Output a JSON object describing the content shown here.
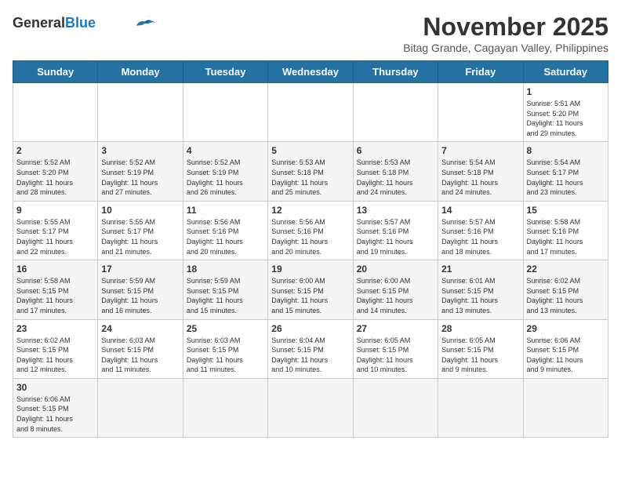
{
  "header": {
    "logo_general": "General",
    "logo_blue": "Blue",
    "month_year": "November 2025",
    "location": "Bitag Grande, Cagayan Valley, Philippines"
  },
  "days_of_week": [
    "Sunday",
    "Monday",
    "Tuesday",
    "Wednesday",
    "Thursday",
    "Friday",
    "Saturday"
  ],
  "weeks": [
    [
      {
        "day": "",
        "content": ""
      },
      {
        "day": "",
        "content": ""
      },
      {
        "day": "",
        "content": ""
      },
      {
        "day": "",
        "content": ""
      },
      {
        "day": "",
        "content": ""
      },
      {
        "day": "",
        "content": ""
      },
      {
        "day": "1",
        "content": "Sunrise: 5:51 AM\nSunset: 5:20 PM\nDaylight: 11 hours\nand 29 minutes."
      }
    ],
    [
      {
        "day": "2",
        "content": "Sunrise: 5:52 AM\nSunset: 5:20 PM\nDaylight: 11 hours\nand 28 minutes."
      },
      {
        "day": "3",
        "content": "Sunrise: 5:52 AM\nSunset: 5:19 PM\nDaylight: 11 hours\nand 27 minutes."
      },
      {
        "day": "4",
        "content": "Sunrise: 5:52 AM\nSunset: 5:19 PM\nDaylight: 11 hours\nand 26 minutes."
      },
      {
        "day": "5",
        "content": "Sunrise: 5:53 AM\nSunset: 5:18 PM\nDaylight: 11 hours\nand 25 minutes."
      },
      {
        "day": "6",
        "content": "Sunrise: 5:53 AM\nSunset: 5:18 PM\nDaylight: 11 hours\nand 24 minutes."
      },
      {
        "day": "7",
        "content": "Sunrise: 5:54 AM\nSunset: 5:18 PM\nDaylight: 11 hours\nand 24 minutes."
      },
      {
        "day": "8",
        "content": "Sunrise: 5:54 AM\nSunset: 5:17 PM\nDaylight: 11 hours\nand 23 minutes."
      }
    ],
    [
      {
        "day": "9",
        "content": "Sunrise: 5:55 AM\nSunset: 5:17 PM\nDaylight: 11 hours\nand 22 minutes."
      },
      {
        "day": "10",
        "content": "Sunrise: 5:55 AM\nSunset: 5:17 PM\nDaylight: 11 hours\nand 21 minutes."
      },
      {
        "day": "11",
        "content": "Sunrise: 5:56 AM\nSunset: 5:16 PM\nDaylight: 11 hours\nand 20 minutes."
      },
      {
        "day": "12",
        "content": "Sunrise: 5:56 AM\nSunset: 5:16 PM\nDaylight: 11 hours\nand 20 minutes."
      },
      {
        "day": "13",
        "content": "Sunrise: 5:57 AM\nSunset: 5:16 PM\nDaylight: 11 hours\nand 19 minutes."
      },
      {
        "day": "14",
        "content": "Sunrise: 5:57 AM\nSunset: 5:16 PM\nDaylight: 11 hours\nand 18 minutes."
      },
      {
        "day": "15",
        "content": "Sunrise: 5:58 AM\nSunset: 5:16 PM\nDaylight: 11 hours\nand 17 minutes."
      }
    ],
    [
      {
        "day": "16",
        "content": "Sunrise: 5:58 AM\nSunset: 5:15 PM\nDaylight: 11 hours\nand 17 minutes."
      },
      {
        "day": "17",
        "content": "Sunrise: 5:59 AM\nSunset: 5:15 PM\nDaylight: 11 hours\nand 16 minutes."
      },
      {
        "day": "18",
        "content": "Sunrise: 5:59 AM\nSunset: 5:15 PM\nDaylight: 11 hours\nand 15 minutes."
      },
      {
        "day": "19",
        "content": "Sunrise: 6:00 AM\nSunset: 5:15 PM\nDaylight: 11 hours\nand 15 minutes."
      },
      {
        "day": "20",
        "content": "Sunrise: 6:00 AM\nSunset: 5:15 PM\nDaylight: 11 hours\nand 14 minutes."
      },
      {
        "day": "21",
        "content": "Sunrise: 6:01 AM\nSunset: 5:15 PM\nDaylight: 11 hours\nand 13 minutes."
      },
      {
        "day": "22",
        "content": "Sunrise: 6:02 AM\nSunset: 5:15 PM\nDaylight: 11 hours\nand 13 minutes."
      }
    ],
    [
      {
        "day": "23",
        "content": "Sunrise: 6:02 AM\nSunset: 5:15 PM\nDaylight: 11 hours\nand 12 minutes."
      },
      {
        "day": "24",
        "content": "Sunrise: 6:03 AM\nSunset: 5:15 PM\nDaylight: 11 hours\nand 11 minutes."
      },
      {
        "day": "25",
        "content": "Sunrise: 6:03 AM\nSunset: 5:15 PM\nDaylight: 11 hours\nand 11 minutes."
      },
      {
        "day": "26",
        "content": "Sunrise: 6:04 AM\nSunset: 5:15 PM\nDaylight: 11 hours\nand 10 minutes."
      },
      {
        "day": "27",
        "content": "Sunrise: 6:05 AM\nSunset: 5:15 PM\nDaylight: 11 hours\nand 10 minutes."
      },
      {
        "day": "28",
        "content": "Sunrise: 6:05 AM\nSunset: 5:15 PM\nDaylight: 11 hours\nand 9 minutes."
      },
      {
        "day": "29",
        "content": "Sunrise: 6:06 AM\nSunset: 5:15 PM\nDaylight: 11 hours\nand 9 minutes."
      }
    ],
    [
      {
        "day": "30",
        "content": "Sunrise: 6:06 AM\nSunset: 5:15 PM\nDaylight: 11 hours\nand 8 minutes."
      },
      {
        "day": "",
        "content": ""
      },
      {
        "day": "",
        "content": ""
      },
      {
        "day": "",
        "content": ""
      },
      {
        "day": "",
        "content": ""
      },
      {
        "day": "",
        "content": ""
      },
      {
        "day": "",
        "content": ""
      }
    ]
  ]
}
